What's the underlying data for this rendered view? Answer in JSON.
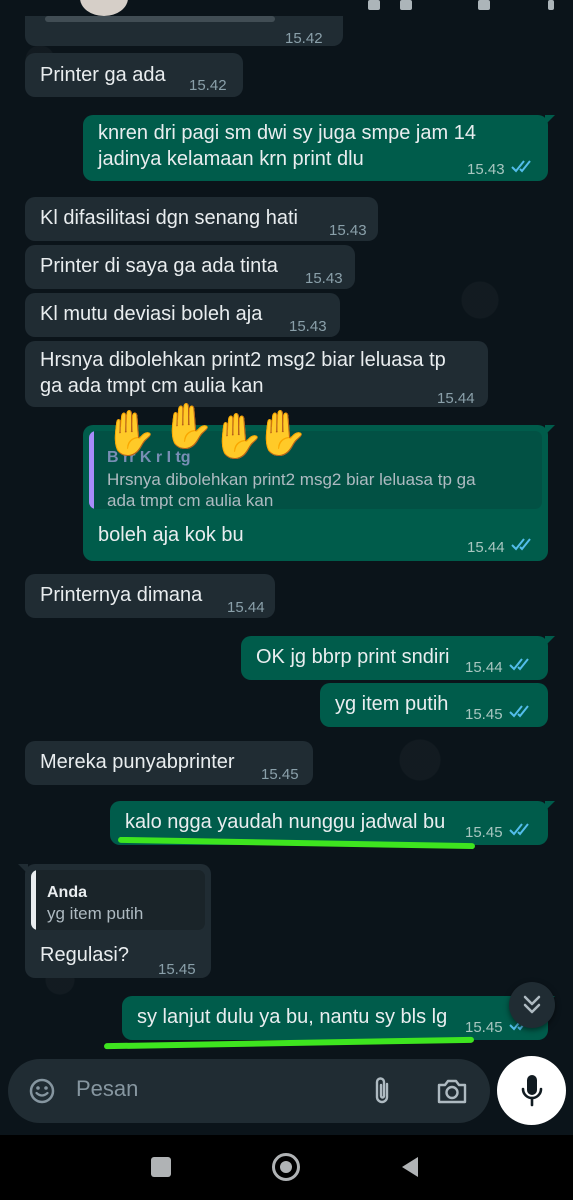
{
  "chat": {
    "partial_top_time": "15.42",
    "messages": [
      {
        "id": "m1",
        "dir": "in",
        "text": "Printer ga ada",
        "time": "15.42"
      },
      {
        "id": "m2",
        "dir": "out",
        "lines": [
          "knren dri pagi sm dwi sy juga smpe jam 14",
          "jadinya kelamaan krn print dlu"
        ],
        "time": "15.43"
      },
      {
        "id": "m3",
        "dir": "in",
        "text": "Kl difasilitasi dgn senang hati",
        "time": "15.43"
      },
      {
        "id": "m4",
        "dir": "in",
        "text": "Printer di saya ga ada tinta",
        "time": "15.43"
      },
      {
        "id": "m5",
        "dir": "in",
        "text": "Kl mutu deviasi boleh aja",
        "time": "15.43"
      },
      {
        "id": "m6",
        "dir": "in",
        "lines": [
          "Hrsnya dibolehkan print2 msg2 biar leluasa tp",
          "ga ada tmpt cm aulia kan"
        ],
        "time": "15.44"
      },
      {
        "id": "m7",
        "dir": "out",
        "quote": {
          "name_visible": "B        rr    K   r  I  tg",
          "lines": [
            "Hrsnya dibolehkan print2 msg2 biar leluasa tp ga",
            "ada tmpt cm aulia kan"
          ]
        },
        "text": "boleh aja kok bu",
        "time": "15.44"
      },
      {
        "id": "m8",
        "dir": "in",
        "text": "Printernya dimana",
        "time": "15.44"
      },
      {
        "id": "m9",
        "dir": "out",
        "text": "OK jg bbrp print sndiri",
        "time": "15.44"
      },
      {
        "id": "m10",
        "dir": "out",
        "text": "yg item putih",
        "time": "15.45"
      },
      {
        "id": "m11",
        "dir": "in",
        "text": "Mereka punyabprinter",
        "time": "15.45"
      },
      {
        "id": "m12",
        "dir": "out",
        "text": "kalo ngga yaudah nunggu jadwal bu",
        "time": "15.45"
      },
      {
        "id": "m13",
        "dir": "in",
        "quote": {
          "name": "Anda",
          "text": "yg item putih"
        },
        "text": "Regulasi?",
        "time": "15.45"
      },
      {
        "id": "m14",
        "dir": "out",
        "text": "sy lanjut dulu ya bu, nantu sy bls lg",
        "time": "15.45"
      }
    ]
  },
  "composer": {
    "placeholder": "Pesan"
  },
  "icons": {
    "emoji": "emoji-icon",
    "attach": "paperclip-icon",
    "camera": "camera-icon",
    "mic": "microphone-icon",
    "scroll_down": "double-chevron-down-icon",
    "nav_recent": "recent-apps-icon",
    "nav_home": "home-icon",
    "nav_back": "back-icon"
  },
  "colors": {
    "background": "#0b141a",
    "incoming": "#202c33",
    "outgoing": "#005c4b",
    "read_ticks": "#53bdeb",
    "highlight": "#3ee51f"
  }
}
